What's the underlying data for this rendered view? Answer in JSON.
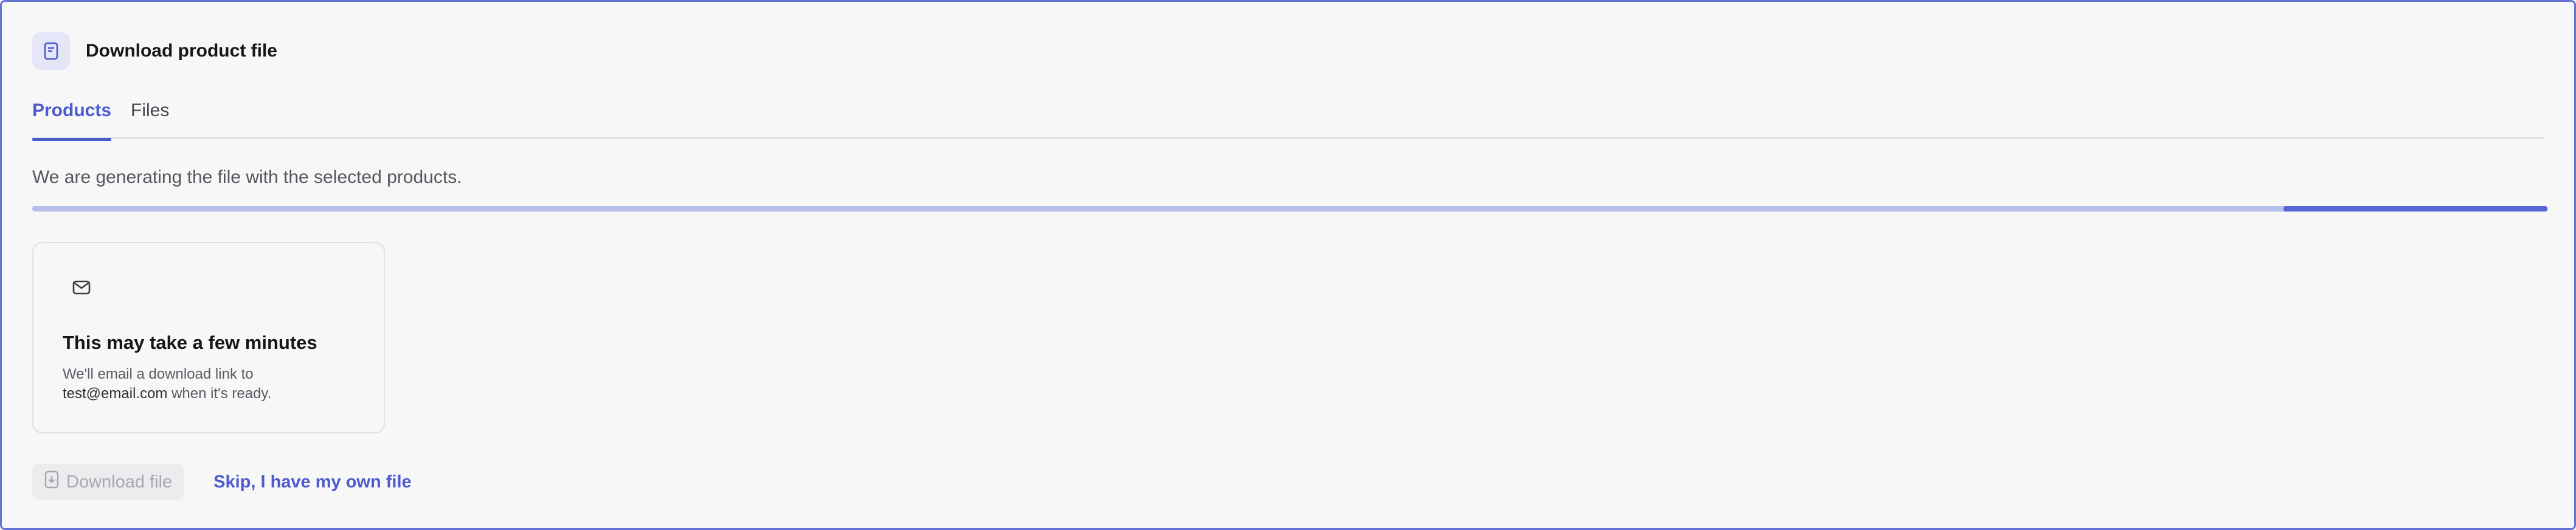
{
  "header": {
    "title": "Download product file",
    "icon": "document-icon"
  },
  "tabs": [
    {
      "label": "Products",
      "active": true
    },
    {
      "label": "Files",
      "active": false
    }
  ],
  "status": {
    "message": "We are generating the file with the selected products.",
    "progress_segment_start": 0.895,
    "progress_segment_end": 1.0
  },
  "card": {
    "icon": "mail-icon",
    "title": "This may take a few minutes",
    "body_prefix": "We'll email a download link to",
    "email": "test@email.com",
    "body_suffix": "when it's ready."
  },
  "actions": {
    "download_label": "Download file",
    "download_icon": "download-file-icon",
    "download_disabled": true,
    "skip_label": "Skip, I have my own file"
  },
  "colors": {
    "accent": "#4b5bce",
    "progress_track": "#b6bfec",
    "progress_fill": "#5566d4",
    "frame_border": "#6673d6"
  }
}
